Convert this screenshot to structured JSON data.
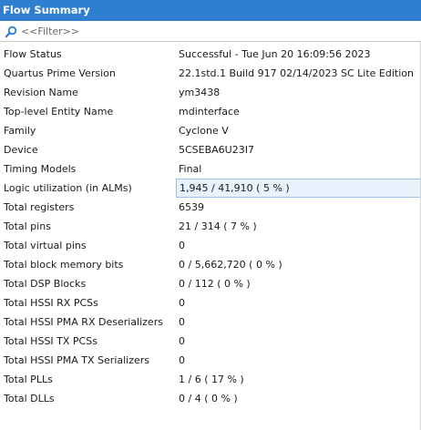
{
  "panel": {
    "title": "Flow Summary"
  },
  "filter": {
    "placeholder": "<<Filter>>",
    "icon": "search-icon"
  },
  "colors": {
    "title_bar": "#2f7fd0",
    "selection_bg": "#e8f2fc",
    "selection_border": "#9cc3ea"
  },
  "rows": [
    {
      "label": "Flow Status",
      "value": "Successful - Tue Jun 20 16:09:56 2023"
    },
    {
      "label": "Quartus Prime Version",
      "value": "22.1std.1 Build 917 02/14/2023 SC Lite Edition"
    },
    {
      "label": "Revision Name",
      "value": "ym3438"
    },
    {
      "label": "Top-level Entity Name",
      "value": "mdinterface"
    },
    {
      "label": "Family",
      "value": "Cyclone V"
    },
    {
      "label": "Device",
      "value": "5CSEBA6U23I7"
    },
    {
      "label": "Timing Models",
      "value": "Final"
    },
    {
      "label": "Logic utilization (in ALMs)",
      "value": "1,945 / 41,910 ( 5 % )"
    },
    {
      "label": "Total registers",
      "value": "6539"
    },
    {
      "label": "Total pins",
      "value": "21 / 314 ( 7 % )"
    },
    {
      "label": "Total virtual pins",
      "value": "0"
    },
    {
      "label": "Total block memory bits",
      "value": "0 / 5,662,720 ( 0 % )"
    },
    {
      "label": "Total DSP Blocks",
      "value": "0 / 112 ( 0 % )"
    },
    {
      "label": "Total HSSI RX PCSs",
      "value": "0"
    },
    {
      "label": "Total HSSI PMA RX Deserializers",
      "value": "0"
    },
    {
      "label": "Total HSSI TX PCSs",
      "value": "0"
    },
    {
      "label": "Total HSSI PMA TX Serializers",
      "value": "0"
    },
    {
      "label": "Total PLLs",
      "value": "1 / 6 ( 17 % )"
    },
    {
      "label": "Total DLLs",
      "value": "0 / 4 ( 0 % )"
    }
  ]
}
